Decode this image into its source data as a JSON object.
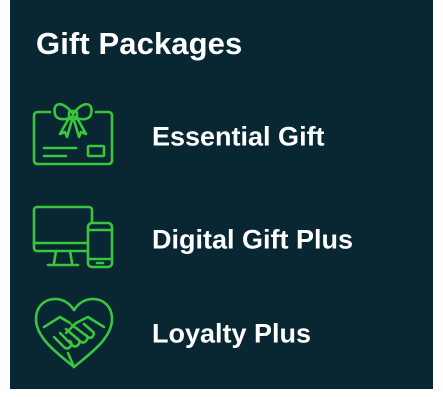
{
  "header": {
    "title": "Gift Packages"
  },
  "colors": {
    "panel_background": "#082733",
    "accent_green": "#3BC43D",
    "text": "#ffffff"
  },
  "packages": [
    {
      "label": "Essential Gift",
      "icon": "gift-card-bow-icon"
    },
    {
      "label": "Digital Gift Plus",
      "icon": "devices-icon"
    },
    {
      "label": "Loyalty Plus",
      "icon": "handshake-heart-icon"
    }
  ]
}
